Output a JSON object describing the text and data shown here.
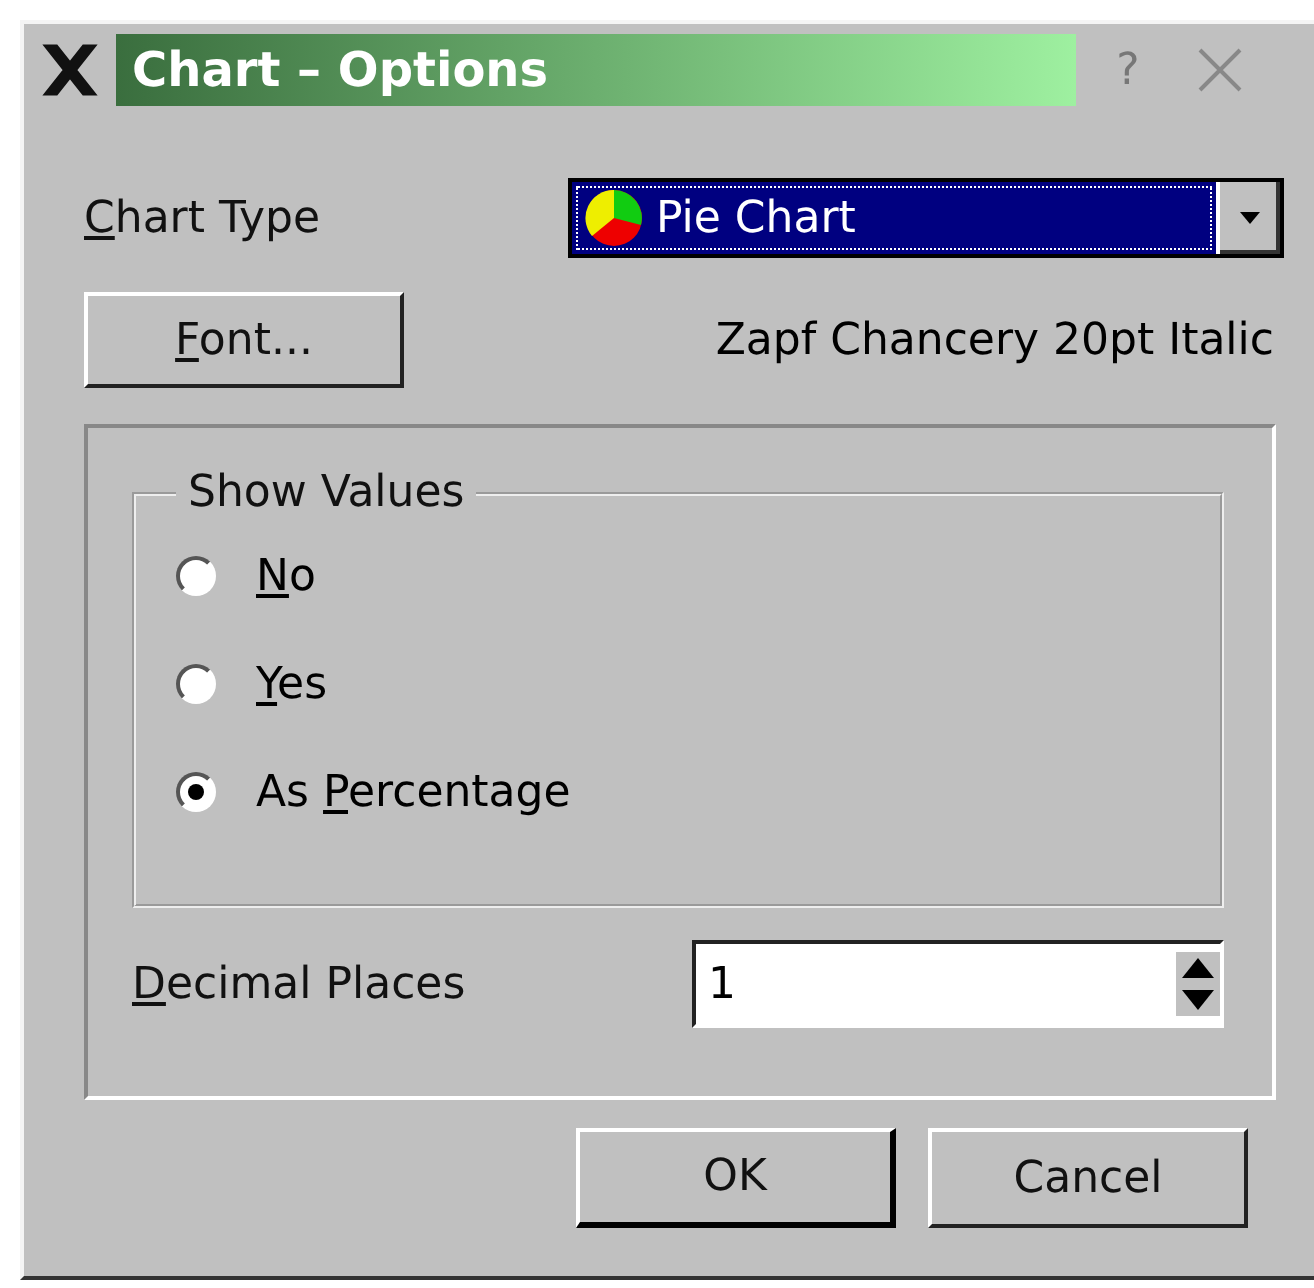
{
  "window": {
    "title": "Chart – Options",
    "buttons": [
      {
        "kind": "help",
        "label": "?"
      },
      {
        "kind": "close"
      }
    ]
  },
  "chart_type": {
    "label": {
      "key": "C",
      "after": "hart Type"
    },
    "value": "Pie Chart",
    "selected": true
  },
  "font": {
    "button": {
      "key": "F",
      "after": "ont..."
    },
    "value": "Zapf Chancery 20pt Italic"
  },
  "show_values": {
    "title": "Show Values",
    "options": [
      {
        "label": {
          "key": "N",
          "after": "o"
        },
        "selected": false
      },
      {
        "label": {
          "key": "Y",
          "after": "es"
        },
        "selected": false
      },
      {
        "label": {
          "before": "As ",
          "key": "P",
          "after": "ercentage"
        },
        "selected": true
      }
    ]
  },
  "decimal_places": {
    "label": {
      "key": "D",
      "after": "ecimal Places"
    },
    "value": "1"
  },
  "buttons": [
    {
      "label": "OK",
      "default": true
    },
    {
      "label": "Cancel",
      "default": false
    }
  ]
}
